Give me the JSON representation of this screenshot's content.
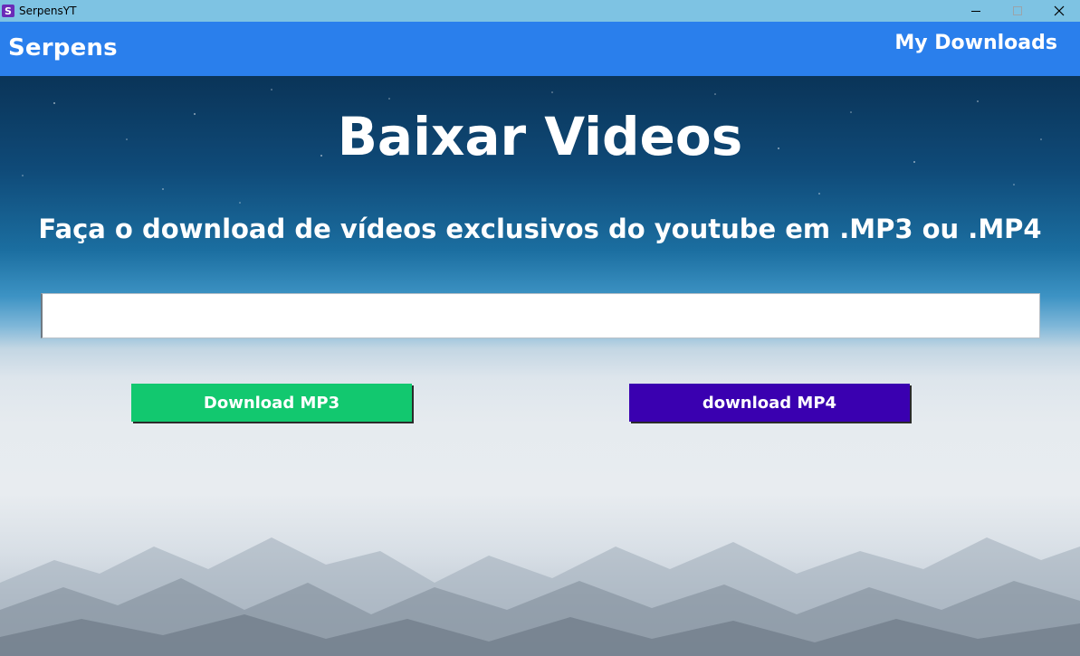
{
  "window": {
    "title": "SerpensYT",
    "icon_letter": "S",
    "icon_color": "#6a2bb8"
  },
  "header": {
    "brand": "Serpens",
    "nav_link": "My Downloads",
    "color": "#2a7fec"
  },
  "main": {
    "title": "Baixar Videos",
    "subtitle": "Faça o download de vídeos exclusivos do youtube em .MP3 ou .MP4",
    "url_input": {
      "value": "",
      "placeholder": ""
    },
    "buttons": {
      "mp3": {
        "label": "Download MP3",
        "color": "#12c86f"
      },
      "mp4": {
        "label": "download MP4",
        "color": "#3a00b0"
      }
    }
  }
}
